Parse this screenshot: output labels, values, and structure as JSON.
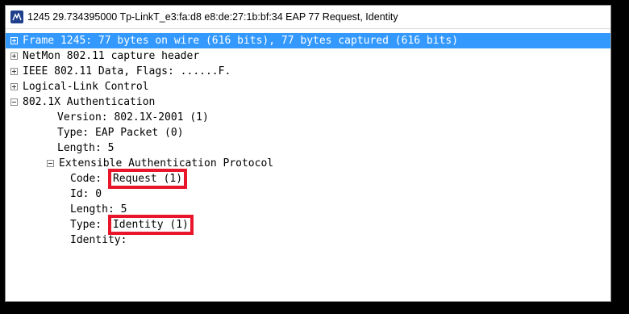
{
  "window": {
    "title": "1245 29.734395000 Tp-LinkT_e3:fa:d8 e8:de:27:1b:bf:34 EAP 77 Request, Identity"
  },
  "tree": {
    "frame": "Frame 1245: 77 bytes on wire (616 bits), 77 bytes captured (616 bits)",
    "netmon": "NetMon 802.11 capture header",
    "ieee": "IEEE 802.11 Data, Flags: ......F.",
    "llc": "Logical-Link Control",
    "auth": "802.1X Authentication",
    "version": "Version: 802.1X-2001 (1)",
    "type": "Type: EAP Packet (0)",
    "length": "Length: 5",
    "eap": "Extensible Authentication Protocol",
    "code_label": "Code: ",
    "code_value": "Request (1)",
    "id": "Id: 0",
    "eap_length": "Length: 5",
    "eap_type_label": "Type: ",
    "eap_type_value": "Identity (1)",
    "identity": "Identity:"
  },
  "colors": {
    "selection": "#3399ff",
    "highlight_box": "#e8162b"
  }
}
